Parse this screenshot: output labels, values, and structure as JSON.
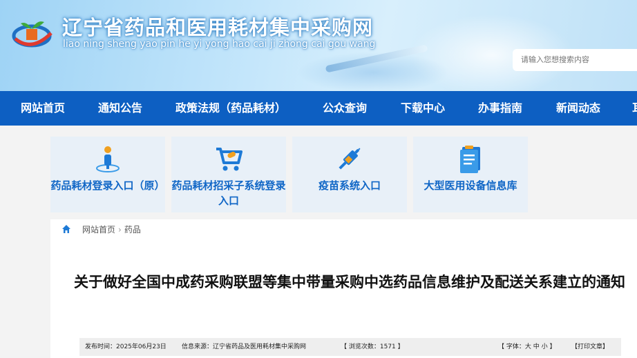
{
  "header": {
    "title": "辽宁省药品和医用耗材集中采购网",
    "pinyin": "liao ning sheng yao pin he yi yong hao cai ji zhong cai gou wang",
    "search_placeholder": "请输入您想搜索内容"
  },
  "nav": {
    "items": [
      {
        "label": "网站首页"
      },
      {
        "label": "通知公告"
      },
      {
        "label": "政策法规（药品耗材）"
      },
      {
        "label": "公众查询"
      },
      {
        "label": "下载中心"
      },
      {
        "label": "办事指南"
      },
      {
        "label": "新闻动态"
      },
      {
        "label": "耳"
      }
    ]
  },
  "entries": [
    {
      "label": "药品耗材登录入口（原）",
      "icon": "person-location-icon"
    },
    {
      "label": "药品耗材招采子系统登录入口",
      "icon": "shopping-cart-icon"
    },
    {
      "label": "疫苗系统入口",
      "icon": "syringe-icon"
    },
    {
      "label": "大型医用设备信息库",
      "icon": "document-list-icon"
    }
  ],
  "breadcrumb": {
    "home": "网站首页",
    "separator": "›",
    "current": "药品"
  },
  "article": {
    "title": "关于做好全国中成药采购联盟等集中带量采购中选药品信息维护及配送关系建立的通知",
    "publish_time": "发布时间：2025年06月23日",
    "source": "信息来源：辽宁省药品及医用耗材集中采购网",
    "views": "【 浏览次数：1571 】",
    "font_size": "【 字体：大 中 小 】",
    "print": "【打印文章】"
  },
  "colors": {
    "nav_bg": "#0d5fc2",
    "entry_text": "#1066c6",
    "entry_bg": "#e8f0f8"
  }
}
